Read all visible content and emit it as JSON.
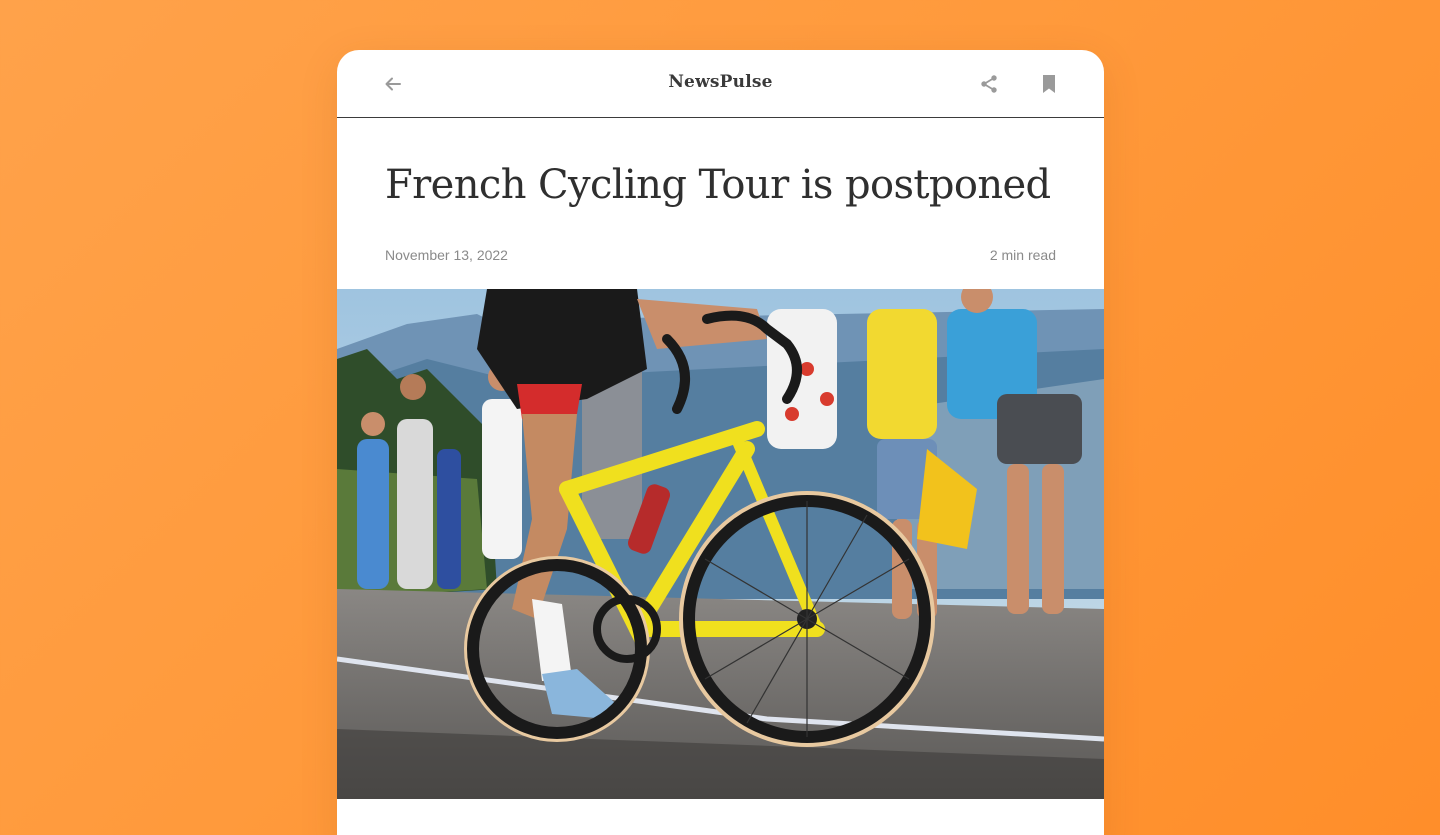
{
  "app": {
    "brand": "NewsPulse"
  },
  "toolbar": {
    "back_icon": "arrow-left-icon",
    "share_icon": "share-icon",
    "bookmark_icon": "bookmark-icon"
  },
  "article": {
    "title": "French Cycling Tour is postponed",
    "date": "November 13, 2022",
    "read_time": "2 min read",
    "hero_image": "cyclist-with-spectators-photo"
  },
  "colors": {
    "background": "#ff9a3c",
    "card": "#ffffff",
    "title_text": "#2f2f2f",
    "meta_text": "#8a8a8a",
    "icon_gray": "#9a9a9a"
  }
}
